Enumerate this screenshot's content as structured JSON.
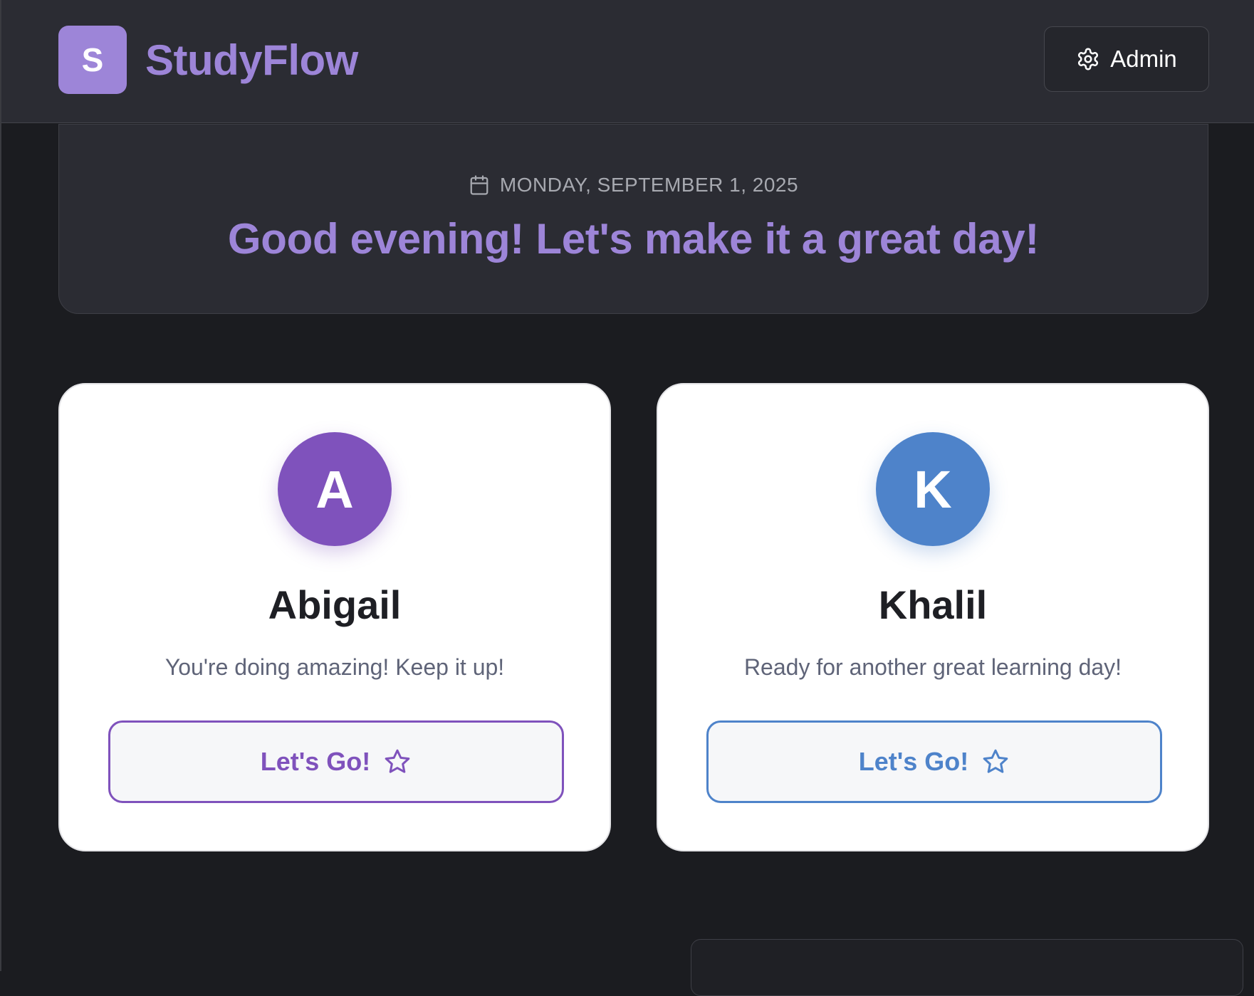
{
  "header": {
    "logo_letter": "S",
    "brand": "StudyFlow",
    "admin_label": "Admin"
  },
  "greeting": {
    "date": "MONDAY, SEPTEMBER 1, 2025",
    "message": "Good evening! Let's make it a great day!"
  },
  "students": [
    {
      "initial": "A",
      "name": "Abigail",
      "message": "You're doing amazing! Keep it up!",
      "button_label": "Let's Go!",
      "color": "#7f52bc"
    },
    {
      "initial": "K",
      "name": "Khalil",
      "message": "Ready for another great learning day!",
      "button_label": "Let's Go!",
      "color": "#4e83ca"
    }
  ],
  "icons": {
    "admin": "gear-icon",
    "date": "calendar-icon",
    "button": "star-icon"
  },
  "colors": {
    "brand": "#9d85d8",
    "background": "#1b1c20",
    "header": "#2b2c33"
  }
}
